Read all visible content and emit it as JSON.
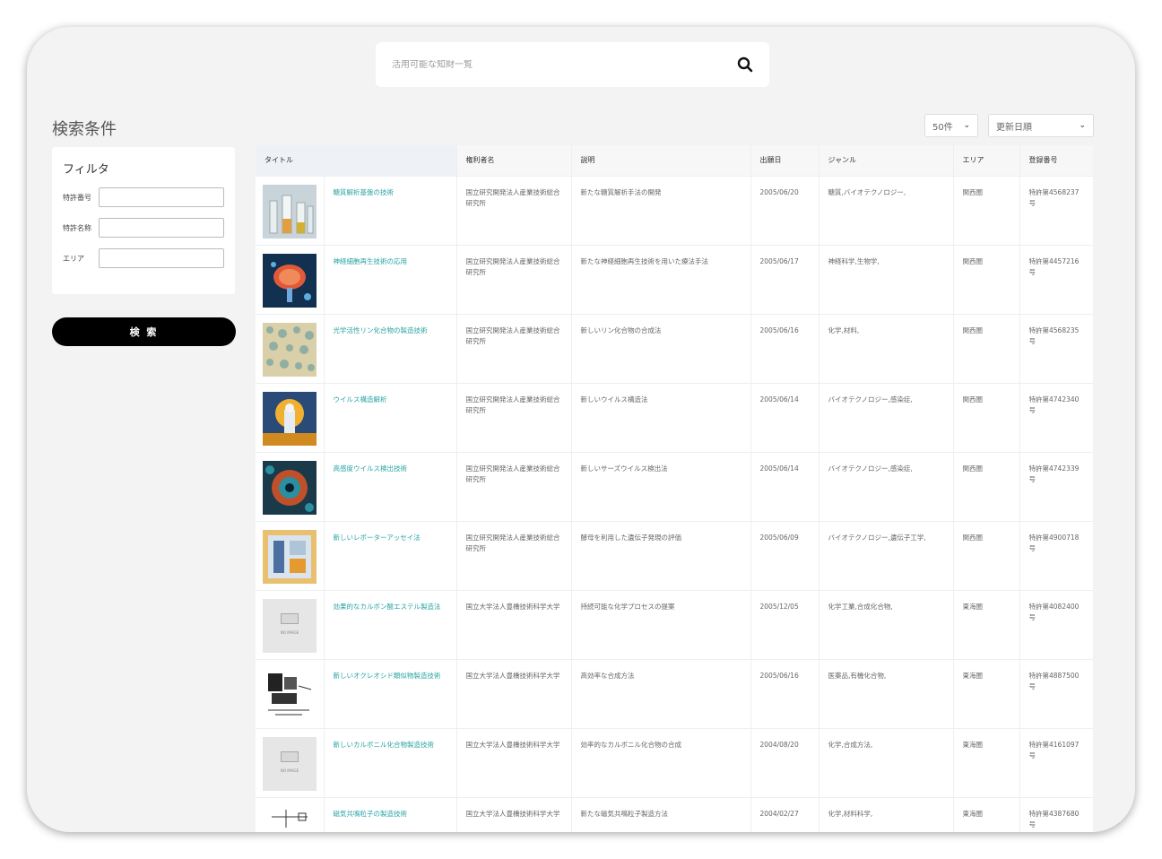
{
  "search": {
    "placeholder": "活用可能な知財一覧"
  },
  "sidebar": {
    "title": "検索条件",
    "filter_heading": "フィルタ",
    "fields": [
      {
        "label": "特許番号"
      },
      {
        "label": "特許名称"
      },
      {
        "label": "エリア"
      }
    ],
    "search_button": "検 索"
  },
  "controls": {
    "per_page": "50件",
    "sort": "更新日順"
  },
  "table": {
    "headers": [
      "タイトル",
      "",
      "権利者名",
      "説明",
      "出願日",
      "ジャンル",
      "エリア",
      "登録番号"
    ],
    "rows": [
      {
        "thumb": "lab-flasks",
        "title": "糖質解析基盤の技術",
        "owner": "国立研究開発法人産業技術総合研究所",
        "desc": "新たな糖質解析手法の開発",
        "date": "2005/06/20",
        "genre": "糖質,バイオテクノロジー,",
        "area": "関西圏",
        "reg": "特許第4568237号"
      },
      {
        "thumb": "brain",
        "title": "神経細胞再生技術の応用",
        "owner": "国立研究開発法人産業技術総合研究所",
        "desc": "新たな神経細胞再生技術を用いた療法手法",
        "date": "2005/06/17",
        "genre": "神経科学,生物学,",
        "area": "関西圏",
        "reg": "特許第4457216号"
      },
      {
        "thumb": "cells",
        "title": "光学活性リン化合物の製造技術",
        "owner": "国立研究開発法人産業技術総合研究所",
        "desc": "新しいリン化合物の合成法",
        "date": "2005/06/16",
        "genre": "化学,材料,",
        "area": "関西圏",
        "reg": "特許第4568235号"
      },
      {
        "thumb": "virus-art",
        "title": "ウイルス構造解析",
        "owner": "国立研究開発法人産業技術総合研究所",
        "desc": "新しいウイルス構造法",
        "date": "2005/06/14",
        "genre": "バイオテクノロジー,感染症,",
        "area": "関西圏",
        "reg": "特許第4742340号"
      },
      {
        "thumb": "virus",
        "title": "高感度ウイルス検出技術",
        "owner": "国立研究開発法人産業技術総合研究所",
        "desc": "新しいサーズウイルス検出法",
        "date": "2005/06/14",
        "genre": "バイオテクノロジー,感染症,",
        "area": "関西圏",
        "reg": "特許第4742339号"
      },
      {
        "thumb": "lab",
        "title": "新しいレポーターアッセイ法",
        "owner": "国立研究開発法人産業技術総合研究所",
        "desc": "酵母を利用した遺伝子発現の評価",
        "date": "2005/06/09",
        "genre": "バイオテクノロジー,遺伝子工学,",
        "area": "関西圏",
        "reg": "特許第4900718号"
      },
      {
        "thumb": "noimage",
        "title": "効果的なカルボン酸エステル製造法",
        "owner": "国立大学法人豊橋技術科学大学",
        "desc": "持続可能な化学プロセスの提案",
        "date": "2005/12/05",
        "genre": "化学工業,合成化合物,",
        "area": "東海圏",
        "reg": "特許第4082400号"
      },
      {
        "thumb": "document",
        "title": "新しいオクレオシド類似物製造技術",
        "owner": "国立大学法人豊橋技術科学大学",
        "desc": "高効率な合成方法",
        "date": "2005/06/16",
        "genre": "医薬品,有機化合物,",
        "area": "東海圏",
        "reg": "特許第4887500号"
      },
      {
        "thumb": "noimage",
        "title": "新しいカルボニル化合物製造技術",
        "owner": "国立大学法人豊橋技術科学大学",
        "desc": "効率的なカルボニル化合物の合成",
        "date": "2004/08/20",
        "genre": "化学,合成方法,",
        "area": "東海圏",
        "reg": "特許第4161097号"
      },
      {
        "thumb": "diagram",
        "title": "磁気共鳴粒子の製造技術",
        "owner": "国立大学法人豊橋技術科学大学",
        "desc": "新たな磁気共鳴粒子製造方法",
        "date": "2004/02/27",
        "genre": "化学,材料科学,",
        "area": "東海圏",
        "reg": "特許第4387680号"
      }
    ]
  },
  "colors": {
    "link": "#29a3a3",
    "button": "#000000",
    "page_bg": "#f3f3f3"
  }
}
